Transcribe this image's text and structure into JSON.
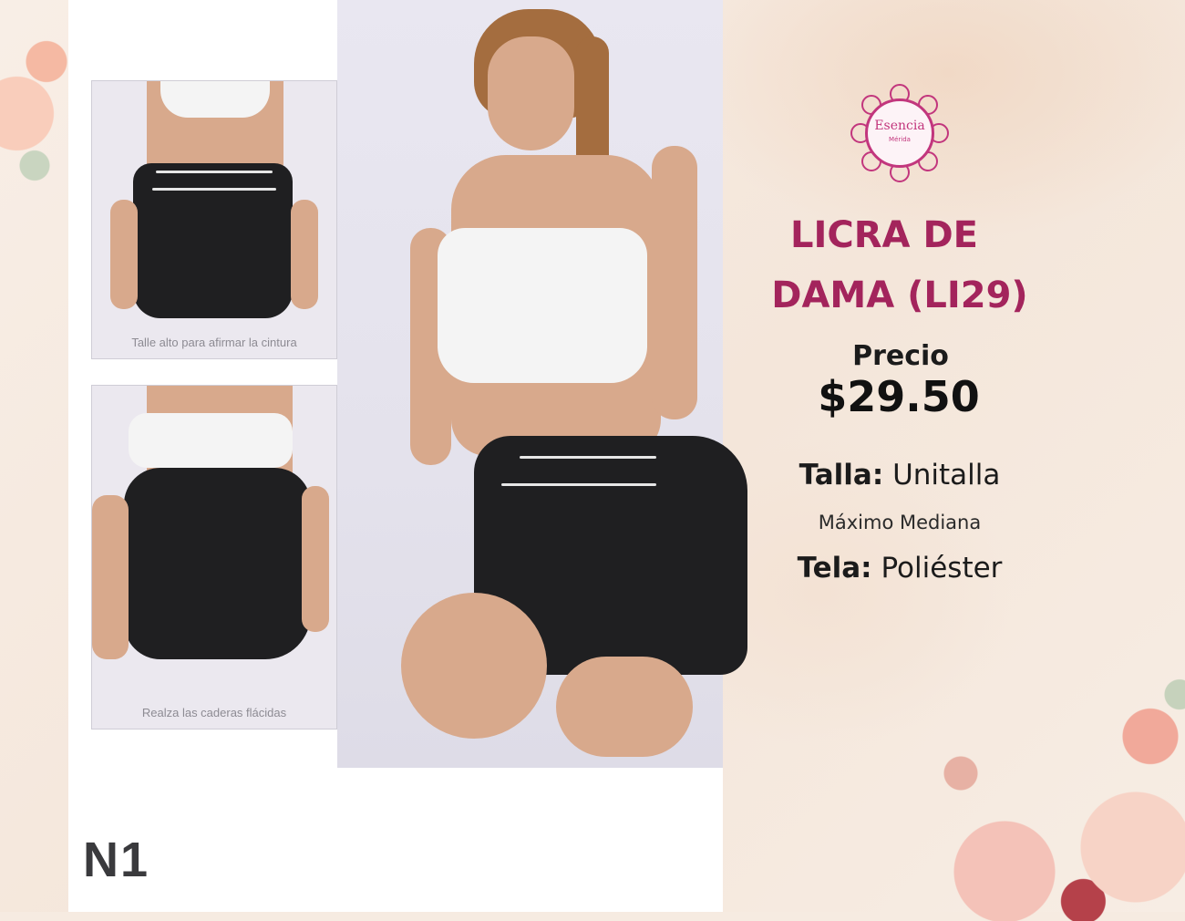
{
  "brand": {
    "logo_name": "Esencia",
    "logo_subtitle": "Mérida"
  },
  "product": {
    "title_line1": "LICRA DE",
    "title_line2": "DAMA (LI29)",
    "price_label": "Precio",
    "price": "$29.50",
    "size_label": "Talla:",
    "size_value": "Unitalla",
    "size_note": "Máximo Mediana",
    "fabric_label": "Tela:",
    "fabric_value": "Poliéster"
  },
  "photos": {
    "inset_top_caption": "Talle alto para afirmar la cintura",
    "inset_bottom_caption": "Realza las caderas flácidas",
    "code_label": "N1"
  },
  "colors": {
    "title": "#a3245c",
    "text": "#1b1b1b",
    "logo": "#c2367d",
    "background": "#f6ebe1"
  }
}
